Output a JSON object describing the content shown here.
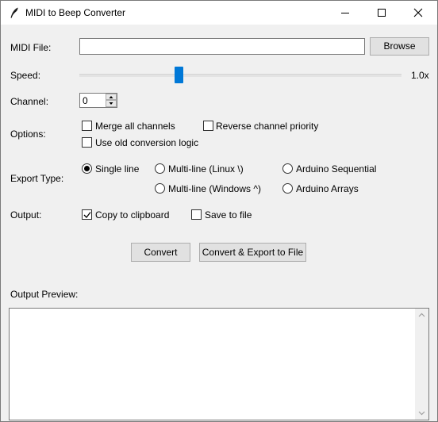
{
  "window": {
    "title": "MIDI to Beep Converter"
  },
  "midi_file": {
    "label": "MIDI File:",
    "value": "",
    "browse_label": "Browse"
  },
  "speed": {
    "label": "Speed:",
    "value_text": "1.0x",
    "level": 0.305
  },
  "channel": {
    "label": "Channel:",
    "value": "0"
  },
  "options": {
    "label": "Options:",
    "merge_all_channels": {
      "label": "Merge all channels",
      "checked": false
    },
    "reverse_channel_priority": {
      "label": "Reverse channel priority",
      "checked": false
    },
    "use_old_conversion_logic": {
      "label": "Use old conversion logic",
      "checked": false
    }
  },
  "export_type": {
    "label": "Export Type:",
    "options": [
      {
        "label": "Single line",
        "selected": true
      },
      {
        "label": "Multi-line (Linux \\)",
        "selected": false
      },
      {
        "label": "Arduino Sequential",
        "selected": false
      },
      {
        "label": "Multi-line (Windows ^)",
        "selected": false
      },
      {
        "label": "Arduino Arrays",
        "selected": false
      }
    ]
  },
  "output": {
    "label": "Output:",
    "copy_to_clipboard": {
      "label": "Copy to clipboard",
      "checked": true
    },
    "save_to_file": {
      "label": "Save to file",
      "checked": false
    }
  },
  "buttons": {
    "convert": "Convert",
    "convert_export": "Convert & Export to File"
  },
  "preview": {
    "label": "Output Preview:",
    "text": ""
  },
  "colors": {
    "accent": "#0078d7",
    "window_bg": "#f0f0f0",
    "titlebar_bg": "#ffffff"
  }
}
